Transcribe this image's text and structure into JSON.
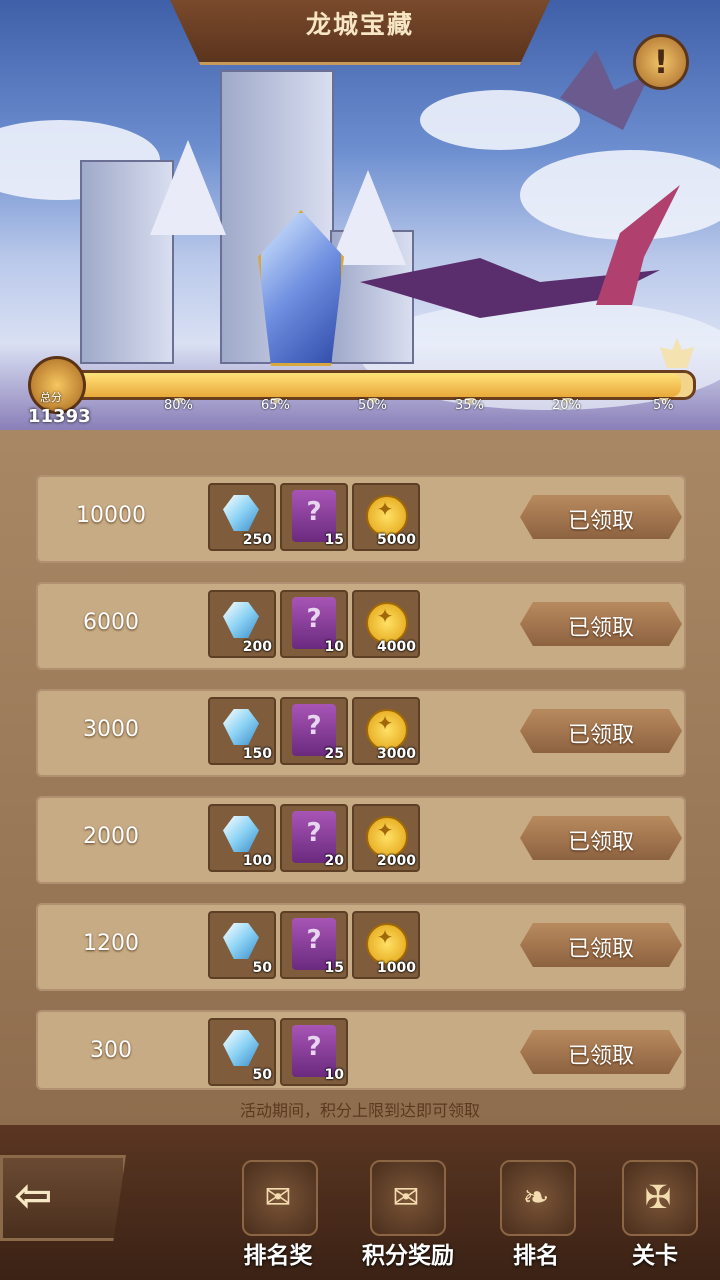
{
  "header": {
    "title": "龙城宝藏",
    "info_icon": "exclamation-icon",
    "info_glyph": "!"
  },
  "progress": {
    "rank_label": "总分",
    "score": "11393",
    "fill_fraction": 0.98,
    "ticks": [
      "80%",
      "65%",
      "50%",
      "35%",
      "20%",
      "5%"
    ]
  },
  "rewards": [
    {
      "score": "10000",
      "items": [
        {
          "icon": "diamond-icon",
          "qty": "250"
        },
        {
          "icon": "scroll-icon",
          "qty": "15"
        },
        {
          "icon": "gold-coin-icon",
          "qty": "5000"
        }
      ],
      "button": "已领取"
    },
    {
      "score": "6000",
      "items": [
        {
          "icon": "diamond-icon",
          "qty": "200"
        },
        {
          "icon": "scroll-icon",
          "qty": "10"
        },
        {
          "icon": "gold-coin-icon",
          "qty": "4000"
        }
      ],
      "button": "已领取"
    },
    {
      "score": "3000",
      "items": [
        {
          "icon": "diamond-icon",
          "qty": "150"
        },
        {
          "icon": "scroll-icon",
          "qty": "25"
        },
        {
          "icon": "gold-coin-icon",
          "qty": "3000"
        }
      ],
      "button": "已领取"
    },
    {
      "score": "2000",
      "items": [
        {
          "icon": "diamond-icon",
          "qty": "100"
        },
        {
          "icon": "scroll-icon",
          "qty": "20"
        },
        {
          "icon": "gold-coin-icon",
          "qty": "2000"
        }
      ],
      "button": "已领取"
    },
    {
      "score": "1200",
      "items": [
        {
          "icon": "diamond-icon",
          "qty": "50"
        },
        {
          "icon": "scroll-icon",
          "qty": "15"
        },
        {
          "icon": "gold-coin-icon",
          "qty": "1000"
        }
      ],
      "button": "已领取"
    },
    {
      "score": "300",
      "items": [
        {
          "icon": "diamond-icon",
          "qty": "50"
        },
        {
          "icon": "scroll-icon",
          "qty": "10"
        }
      ],
      "button": "已领取"
    }
  ],
  "note": "活动期间，积分上限到达即可领取",
  "bottom_nav": {
    "back_icon": "back-arrow-icon",
    "items": [
      {
        "label": "排名奖",
        "icon": "rank-reward-icon"
      },
      {
        "label": "积分奖励",
        "icon": "points-reward-icon"
      },
      {
        "label": "排名",
        "icon": "ranking-icon"
      },
      {
        "label": "关卡",
        "icon": "stage-icon"
      }
    ]
  }
}
